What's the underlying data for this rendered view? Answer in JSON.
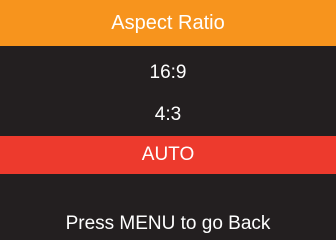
{
  "menu": {
    "title": "Aspect Ratio",
    "options": [
      "16:9",
      "4:3",
      "AUTO"
    ],
    "selected": "AUTO",
    "hint": "Press MENU to go Back"
  },
  "colors": {
    "title_bar": "#f7941d",
    "selected_item": "#ed3a2d",
    "background": "#231f20",
    "text": "#ffffff"
  }
}
